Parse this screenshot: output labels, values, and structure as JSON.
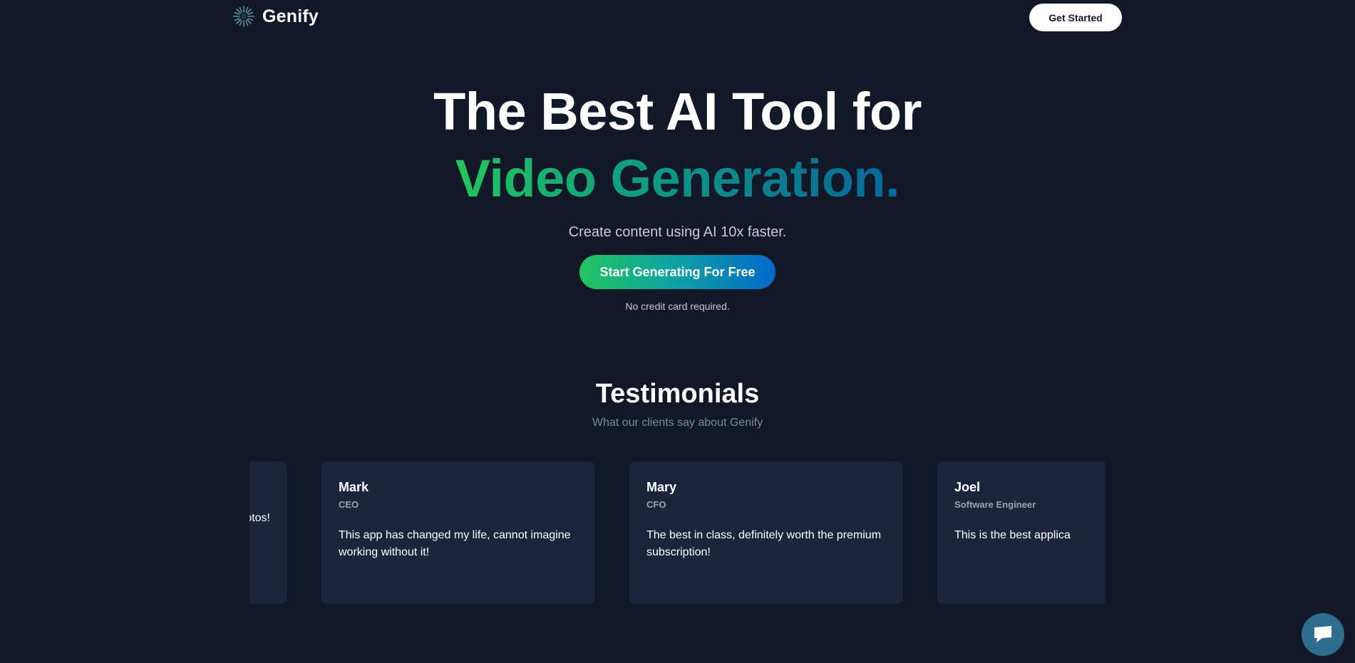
{
  "header": {
    "logo_text": "Genify",
    "get_started_label": "Get Started"
  },
  "hero": {
    "title_line1": "The Best AI Tool for",
    "title_line2": "Video Generation.",
    "subtitle": "Create content using AI 10x faster.",
    "cta_label": "Start Generating For Free",
    "cta_note": "No credit card required."
  },
  "testimonials": {
    "title": "Testimonials",
    "subtitle": "What our clients say about Genify",
    "cards": [
      {
        "name": "",
        "role": "",
        "text": "ew photos!"
      },
      {
        "name": "Mark",
        "role": "CEO",
        "text": "This app has changed my life, cannot imagine working without it!"
      },
      {
        "name": "Mary",
        "role": "CFO",
        "text": "The best in class, definitely worth the premium subscription!"
      },
      {
        "name": "Joel",
        "role": "Software Engineer",
        "text": "This is the best applica"
      }
    ]
  },
  "colors": {
    "background": "#111827",
    "card": "#1b253b",
    "gradient_start": "#22c55e",
    "gradient_end": "#0369a1",
    "chat_button": "#2f6e8e"
  },
  "icons": {
    "logo": "sunburst-logo-icon",
    "chat": "chat-bubble-icon"
  }
}
